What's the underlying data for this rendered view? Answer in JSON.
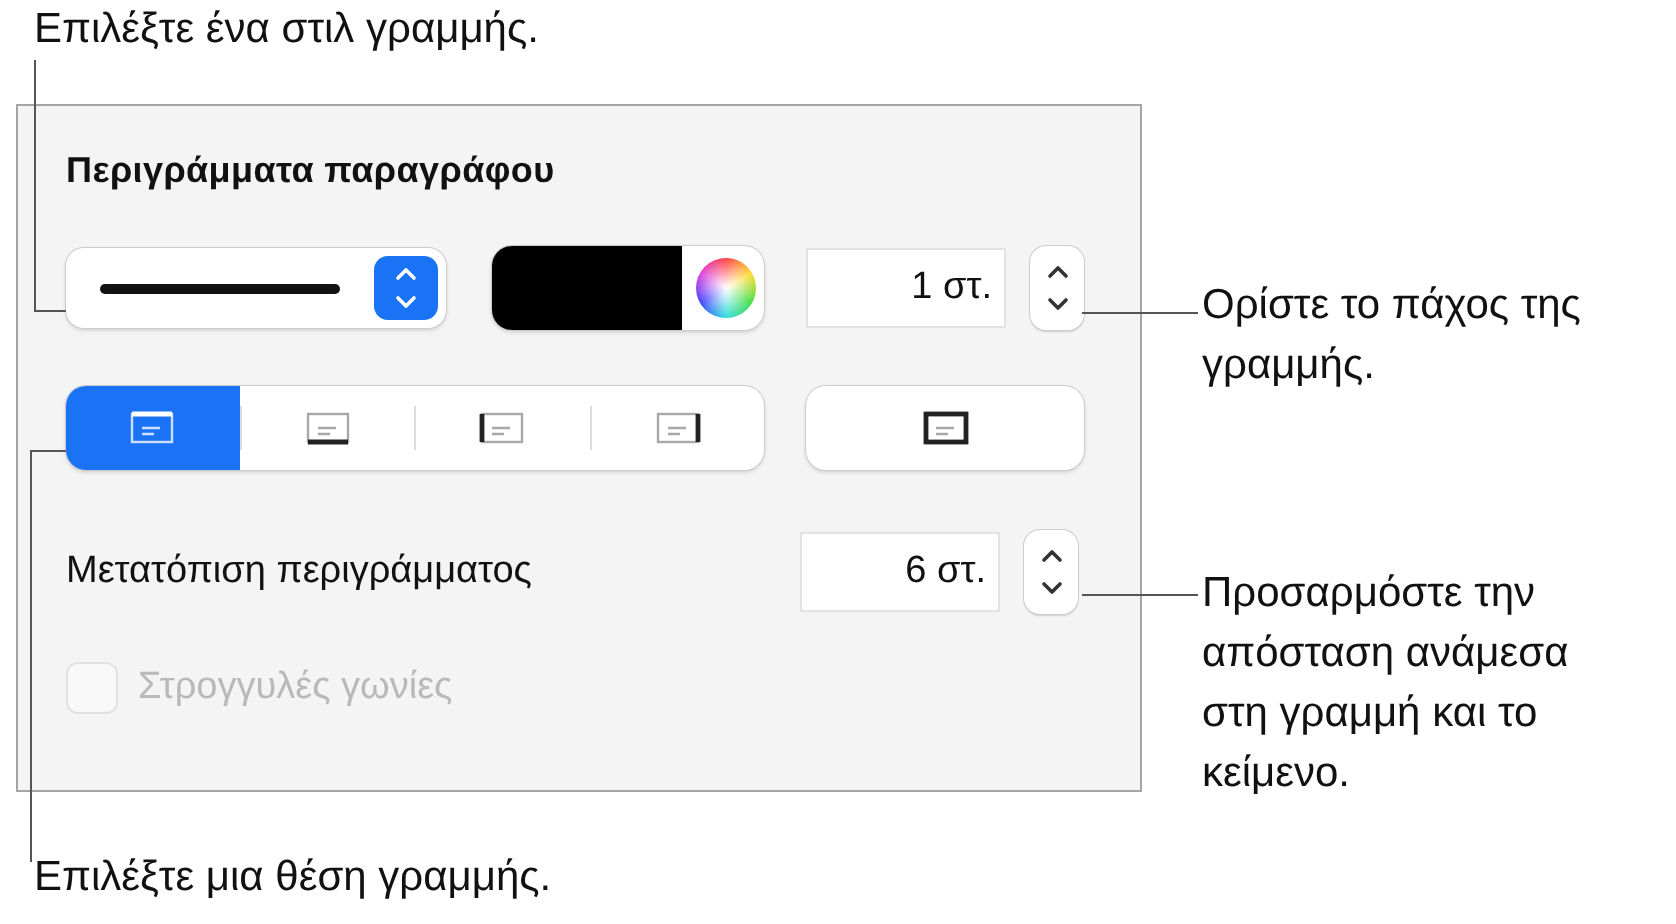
{
  "callouts": [
    {
      "text": "Επιλέξτε ένα στιλ γραμμής."
    },
    {
      "text": "Ορίστε το πάχος της γραμμής."
    },
    {
      "text": "Προσαρμόστε την απόσταση ανάμεσα στη γραμμή και το κείμενο."
    },
    {
      "text": "Επιλέξτε μια θέση γραμμής."
    }
  ],
  "panel": {
    "title": "Περιγράμματα παραγράφου",
    "width_field": {
      "value": "1 στ."
    },
    "positions": [
      {
        "kind": "top",
        "selected": true
      },
      {
        "kind": "bottom",
        "selected": false
      },
      {
        "kind": "left",
        "selected": false
      },
      {
        "kind": "right",
        "selected": false
      }
    ],
    "outline_button": {
      "kind": "box"
    },
    "offset": {
      "label": "Μετατόπιση περιγράμματος",
      "value": "6 στ."
    },
    "rounded_corners": {
      "label": "Στρογγυλές γωνίες",
      "checked": false,
      "disabled": true
    }
  }
}
